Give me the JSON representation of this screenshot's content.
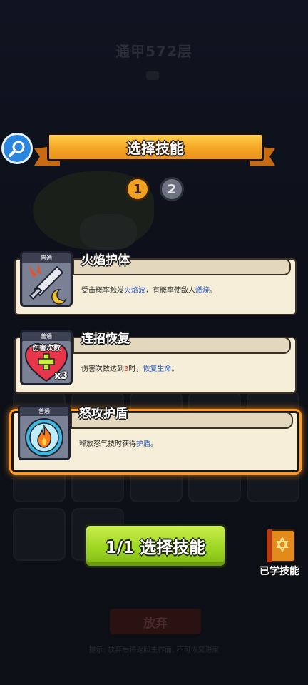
{
  "background": {
    "floor_title": "通甲572层",
    "quit_label": "放弃",
    "hint": "提示: 放弃后将返回主界面, 不可恢复进度"
  },
  "header": {
    "title": "选择技能"
  },
  "pages": [
    "1",
    "2"
  ],
  "skills": [
    {
      "name": "火焰护体",
      "tag": "普通",
      "icon": "sword-flame-moon-icon",
      "desc": [
        "受击概率触发",
        "火焰波",
        "，有概率使敌人",
        "燃烧",
        "。"
      ]
    },
    {
      "name": "连招恢复",
      "tag": "普通",
      "icon": "heart-combo-icon",
      "icon_text": "伤害次数",
      "icon_badge": "x3",
      "desc": [
        "伤害次数达到",
        "3",
        "时，",
        "恢复生命",
        "。"
      ]
    },
    {
      "name": "怒攻护盾",
      "tag": "普通",
      "icon": "flame-shield-icon",
      "selected": true,
      "desc": [
        "释放怒气技时获得",
        "护盾",
        "。"
      ]
    }
  ],
  "confirm_label": "1/1 选择技能",
  "learned_label": "已学技能",
  "colors": {
    "banner": "#f5a623",
    "confirm": "#9ad420",
    "highlight": "#2b5fd0",
    "selected_glow": "#ff9a1e"
  }
}
